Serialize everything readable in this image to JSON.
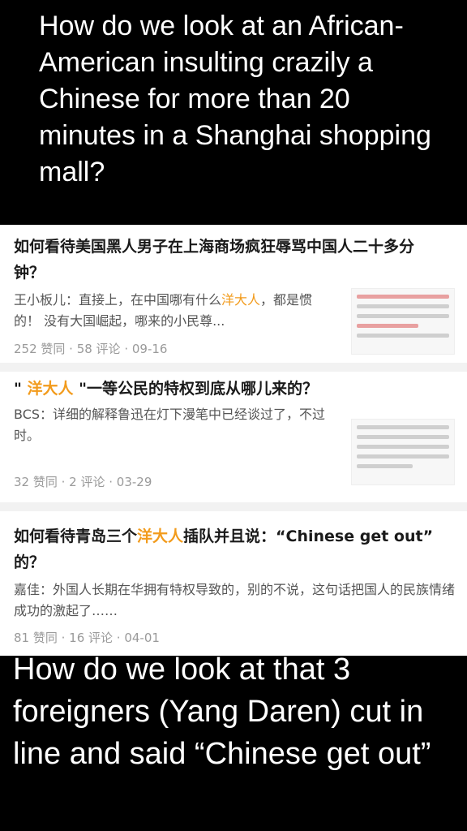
{
  "caption_top": "How do we look at an African-American insulting crazily a Chinese for more than 20 minutes in a Shanghai shopping mall?",
  "cards": [
    {
      "title": "如何看待美国黑人男子在上海商场疯狂辱骂中国人二十多分钟？",
      "excerpt_pre": "王小板儿：直接上，在中国哪有什么",
      "excerpt_hl": "洋大人",
      "excerpt_post": "，都是惯的！ 没有大国崛起，哪来的小民尊...",
      "meta": "252 赞同 · 58 评论 · 09-16"
    },
    {
      "title_pre": "\" ",
      "title_hl": "洋大人",
      "title_post": " \"一等公民的特权到底从哪儿来的？",
      "excerpt": "BCS：详细的解释鲁迅在灯下漫笔中已经谈过了，不过时。",
      "meta": "32 赞同 · 2 评论 · 03-29"
    },
    {
      "title_pre": "如何看待青岛三个",
      "title_hl": "洋大人",
      "title_post": "插队并且说：“Chinese get out” 的？",
      "excerpt": "嘉佳：外国人长期在华拥有特权导致的，别的不说，这句话把国人的民族情绪成功的激起了……",
      "meta": "81 赞同 · 16 评论 · 04-01"
    }
  ],
  "caption_bottom": "How do we look at that 3 foreigners (Yang Daren) cut in line and said “Chinese get out”",
  "colors": {
    "highlight": "#f29b1c",
    "background": "#000000",
    "card": "#ffffff"
  }
}
